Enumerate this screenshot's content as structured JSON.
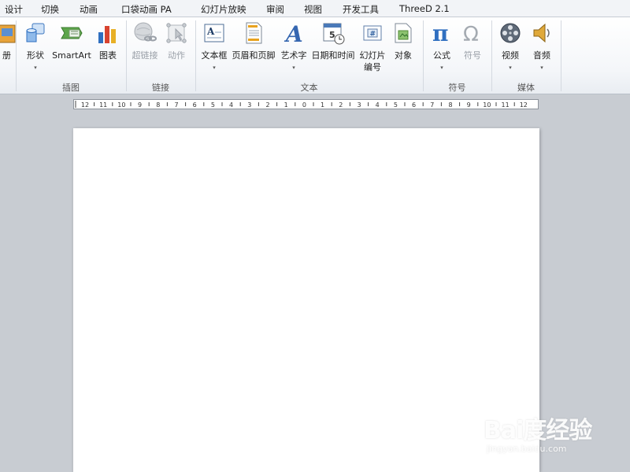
{
  "tabs": [
    "设计",
    "切换",
    "动画",
    "口袋动画 PA",
    "幻灯片放映",
    "审阅",
    "视图",
    "开发工具",
    "ThreeD 2.1"
  ],
  "ribbon": {
    "groups": {
      "illustrations": "插图",
      "links": "链接",
      "text": "文本",
      "symbols": "符号",
      "media": "媒体"
    },
    "buttons": {
      "album": "册",
      "shapes": "形状",
      "smartart": "SmartArt",
      "chart": "图表",
      "hyperlink": "超链接",
      "action": "动作",
      "textbox": "文本框",
      "header_footer": "页眉和页脚",
      "wordart": "艺术字",
      "datetime": "日期和时间",
      "slide_number_1": "幻灯片",
      "slide_number_2": "编号",
      "object": "对象",
      "equation": "公式",
      "symbol": "符号",
      "video": "视频",
      "audio": "音频"
    },
    "dropdown_glyph": "▾",
    "icon_glyphs": {
      "equation": "π",
      "symbol": "Ω",
      "wordart": "A",
      "slide_number": "#"
    }
  },
  "ruler": {
    "labels": [
      "12",
      "11",
      "10",
      "9",
      "8",
      "7",
      "6",
      "5",
      "4",
      "3",
      "2",
      "1",
      "0",
      "1",
      "2",
      "3",
      "4",
      "5",
      "6",
      "7",
      "8",
      "9",
      "10",
      "11",
      "12"
    ]
  },
  "watermark": {
    "logo": "Bai度经验",
    "url": "jingyan.baidu.com"
  },
  "colors": {
    "accent_blue": "#2f6fc0",
    "disabled_gray": "#9aa0a8",
    "workspace": "#c8ccd2"
  }
}
